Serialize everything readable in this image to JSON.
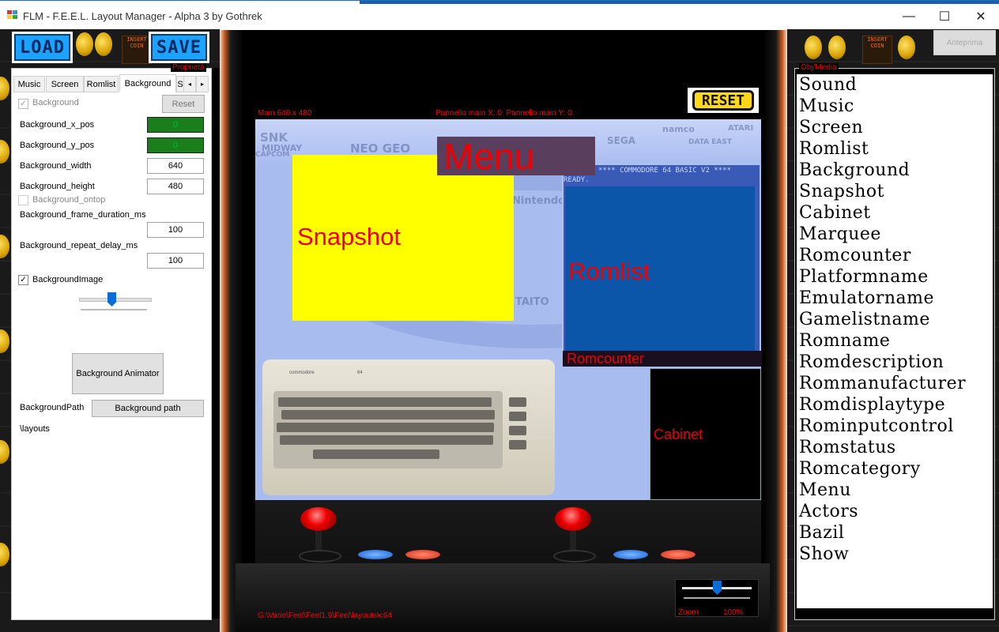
{
  "window": {
    "title": "FLM - F.E.E.L. Layout Manager - Alpha 3 by Gothrek",
    "minimize": "—",
    "maximize": "☐",
    "close": "✕"
  },
  "toolbar": {
    "load_label": "LOAD",
    "save_label": "SAVE",
    "reset_label": "RESET",
    "anteprima_label": "Anteprima"
  },
  "properties": {
    "group_title": "Proprietà",
    "tabs": [
      "Music",
      "Screen",
      "Romlist",
      "Background",
      "S"
    ],
    "active_tab": "Background",
    "background_checkbox": "Background",
    "reset_button": "Reset",
    "fields": [
      {
        "label": "Background_x_pos",
        "value": "0"
      },
      {
        "label": "Background_y_pos",
        "value": "0"
      },
      {
        "label": "Background_width",
        "value": "640"
      },
      {
        "label": "Background_height",
        "value": "480"
      }
    ],
    "ontop_label": "Background_ontop",
    "frame_duration_label": "Background_frame_duration_ms",
    "frame_duration_value": "100",
    "repeat_delay_label": "Background_repeat_delay_ms",
    "repeat_delay_value": "100",
    "image_checkbox_label": "BackgroundImage",
    "slider_level": 0.45,
    "animator_button": "Background Animator",
    "path_label": "BackgroundPath",
    "path_button": "Background path",
    "path_value": "\\layouts"
  },
  "canvas": {
    "main_size": "Main 640 x 480",
    "panel_pos": "Pannello main X: 0  Pannello main Y: 0",
    "menu_label": "Menu",
    "snapshot_label": "Snapshot",
    "romlist_label": "Romlist",
    "romcounter_label": "Romcounter",
    "cabinet_label": "Cabinet",
    "c64_line1": "**** COMMODORE 64 BASIC V2 ****",
    "c64_line2": "READY.",
    "bg_logos": [
      "SNK",
      "MIDWAY",
      "NEO GEO",
      "CAPCOM",
      "SEGA",
      "namco",
      "DATA EAST",
      "ATARI",
      "Nintendo",
      "TAITO"
    ],
    "keyboard_brand": "commodore",
    "keyboard_model": "64",
    "path_text": "G:\\Varie\\Feel\\Feel1.9\\Feel\\layouts\\c64",
    "zoom_label": "Zoom",
    "zoom_value": "100%",
    "zoom_level": 0.5
  },
  "media": {
    "group_title": "Obj/Media",
    "items": [
      "Sound",
      "Music",
      "Screen",
      "Romlist",
      "Background",
      "Snapshot",
      "Cabinet",
      "Marquee",
      "Romcounter",
      "Platformname",
      "Emulatorname",
      "Gamelistname",
      "Romname",
      "Romdescription",
      "Rommanufacturer",
      "Romdisplaytype",
      "Rominputcontrol",
      "Romstatus",
      "Romcategory",
      "Menu",
      "Actors",
      "Bazil",
      "Show"
    ]
  },
  "colors": {
    "accent_blue": "#1aa3ff",
    "label_red": "#ff0000",
    "snapshot_yellow": "#ffff00",
    "romlist_blue": "#0b56a8",
    "field_green": "#1a7f1a"
  },
  "decor": {
    "insert_coin": "INSERT COIN"
  }
}
